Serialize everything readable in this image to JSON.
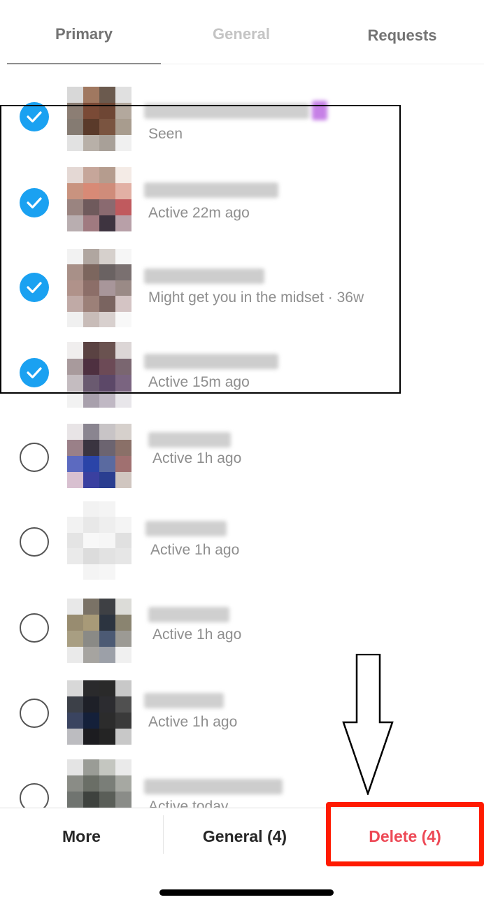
{
  "tabs": {
    "primary": "Primary",
    "general": "General",
    "requests": "Requests"
  },
  "conversations": [
    {
      "checked": true,
      "status": "Seen"
    },
    {
      "checked": true,
      "status": "Active 22m ago"
    },
    {
      "checked": true,
      "status": "Might get you in the midset · 36w"
    },
    {
      "checked": true,
      "status": "Active 15m ago"
    },
    {
      "checked": false,
      "status": "Active 1h ago"
    },
    {
      "checked": false,
      "status": "Active 1h ago"
    },
    {
      "checked": false,
      "status": "Active 1h ago"
    },
    {
      "checked": false,
      "status": "Active 1h ago"
    },
    {
      "checked": false,
      "status": "Active today"
    }
  ],
  "bottom_bar": {
    "more_label": "More",
    "general_label": "General (4)",
    "delete_label": "Delete (4)"
  },
  "colors": {
    "checkbox_checked": "#1aa1f1",
    "delete_text": "#ed4956",
    "highlight_red": "#ff1a00"
  },
  "icons": {
    "checked": "checkmark-icon",
    "annotation": "down-arrow-icon"
  }
}
